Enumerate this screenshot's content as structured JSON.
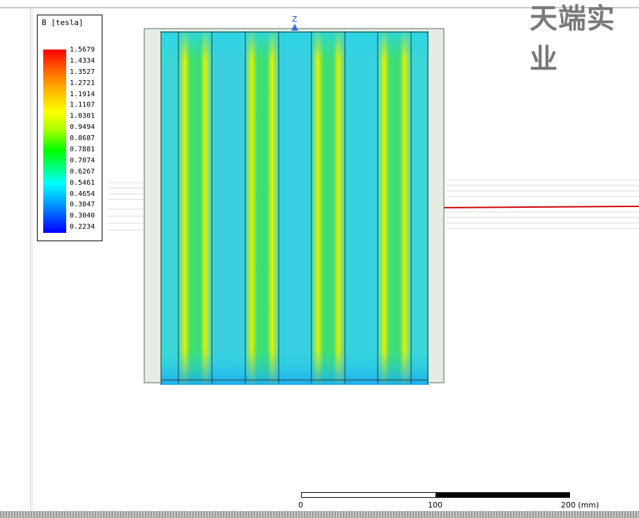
{
  "watermark": {
    "text": "天端实业"
  },
  "legend": {
    "title": "B [tesla]",
    "values": [
      "1.5679",
      "1.4334",
      "1.3527",
      "1.2721",
      "1.1914",
      "1.1107",
      "1.0301",
      "0.9494",
      "0.8687",
      "0.7881",
      "0.7074",
      "0.6267",
      "0.5461",
      "0.4654",
      "0.3847",
      "0.3040",
      "0.2234"
    ]
  },
  "axis": {
    "label": "Z"
  },
  "scale_bar": {
    "label_start": "0",
    "label_mid": "100",
    "label_end": "200 (mm)"
  },
  "colors": {
    "field_green": "#2fe07a",
    "field_cyan": "#27d8e0",
    "field_yellow": "#e6f000",
    "outline": "#2a3a2a",
    "red_line": "#d00000"
  }
}
